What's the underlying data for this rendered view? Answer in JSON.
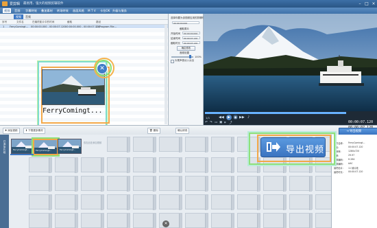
{
  "app": {
    "title": "爱剪辑",
    "subtitle": "最易用、强大的视频剪辑软件"
  },
  "menu": {
    "items": [
      "视频",
      "音频",
      "字幕特效",
      "叠加素材",
      "转场特效",
      "画面风格",
      "M T V",
      "卡拉OK",
      "升级与服务"
    ],
    "active_index": 0
  },
  "left_tabs": {
    "labels": [
      "视频",
      "音频"
    ],
    "active_index": 0
  },
  "video_list": {
    "columns": [
      "序号",
      "文件名",
      "在最终影片中的时间",
      "截取",
      "路径"
    ],
    "rows": [
      {
        "index": "1",
        "name": "FerryComingt...",
        "time": "00:00:00.000 - 00:00:07.120",
        "cut": "00:00:00.000 - 00:00:07.120",
        "path": "C:\\Program File..."
      }
    ]
  },
  "preview_thumb": {
    "label": "FerryComingt..."
  },
  "middle": {
    "section1": "选择你要为该视频应用的剪辑时间",
    "t1": "00:00:00.000",
    "section2": "截取原片",
    "start_label": "开始时间",
    "start_val": "00:00:00.000",
    "end_label": "结束时间",
    "end_val": "00:00:07.120",
    "dur_label": "截取时长",
    "dur_val": "00:00:07.120",
    "confirm_btn": "确定修改",
    "section3": "音频设置",
    "vol_label": "100%",
    "checkbox_label": "头尾声音淡入淡出",
    "apply_btn": "确认修改"
  },
  "player": {
    "elapsed": "00:00:07.120",
    "total": "00:00:07.120",
    "zoom": "1/1"
  },
  "bottom_toolbar": {
    "add_video": "添加视频",
    "download_video": "下载更多素材",
    "delete": "删除",
    "confirm": "确认修改"
  },
  "export": {
    "big_label": "导出视频",
    "small_label": "导出视频"
  },
  "sidebar": {
    "label": "已添加片段"
  },
  "timeline": {
    "clips": [
      "FerryComingt...",
      "FerryComingt...",
      "FerryComingt..."
    ],
    "placeholder": "双击此处添加视频"
  },
  "info_panel": {
    "rows": [
      {
        "label": "文件名称:",
        "value": "FerryComingt..."
      },
      {
        "label": "时长:",
        "value": "00:00:07.120"
      },
      {
        "label": "分辨率:",
        "value": "1280x720"
      },
      {
        "label": "帧率:",
        "value": "29.97"
      },
      {
        "label": "视频编码:",
        "value": "H.264"
      },
      {
        "label": "音频编码:",
        "value": "AAC"
      },
      {
        "label": "最终影片:",
        "value": "11 帧片段"
      },
      {
        "label": "最终时长:",
        "value": "00:00:07.120"
      }
    ]
  },
  "colors": {
    "accent": "#3d78c4",
    "title_bar": "#2a5685",
    "highlight_orange": "#f3a848",
    "highlight_green": "#8fe07a"
  }
}
